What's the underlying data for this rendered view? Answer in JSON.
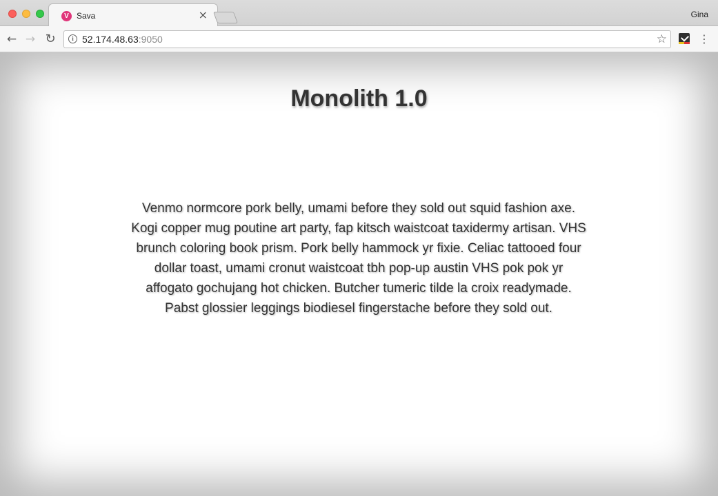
{
  "browser": {
    "tab": {
      "favicon_letter": "V",
      "title": "Sava",
      "close_glyph": "×"
    },
    "profile_name": "Gina",
    "toolbar": {
      "back_glyph": "←",
      "forward_glyph": "→",
      "reload_glyph": "↻",
      "info_glyph": "i",
      "url_host": "52.174.48.63",
      "url_port": ":9050",
      "star_glyph": "☆",
      "menu_glyph": "⋮"
    },
    "icons": {
      "favicon": "vivaldi-v-icon",
      "back": "arrow-left-icon",
      "forward": "arrow-right-icon",
      "reload": "reload-icon",
      "info": "info-circle-icon",
      "bookmark": "star-icon",
      "extension": "checkmark-extension-icon",
      "menu": "vertical-dots-icon"
    },
    "colors": {
      "favicon": "#e0357a",
      "close_light": "#fc605c",
      "minimize_light": "#fdbc40",
      "maximize_light": "#34c84a"
    }
  },
  "page": {
    "title": "Monolith 1.0",
    "body": "Venmo normcore pork belly, umami before they sold out squid fashion axe. Kogi copper mug poutine art party, fap kitsch waistcoat taxidermy artisan. VHS brunch coloring book prism. Pork belly hammock yr fixie. Celiac tattooed four dollar toast, umami cronut waistcoat tbh pop-up austin VHS pok pok yr affogato gochujang hot chicken. Butcher tumeric tilde la croix readymade. Pabst glossier leggings biodiesel fingerstache before they sold out."
  }
}
